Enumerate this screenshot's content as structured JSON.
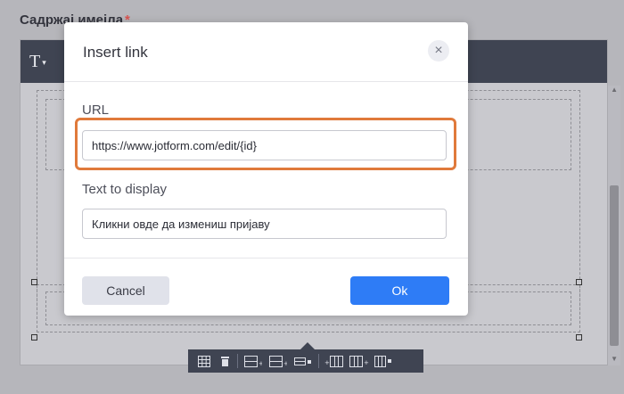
{
  "background": {
    "field_label": "Садржај имејла",
    "required_mark": "*",
    "font_button": "T",
    "font_caret": "▾"
  },
  "dialog": {
    "title": "Insert link",
    "close_icon": "×",
    "url_label": "URL",
    "url_value": "https://www.jotform.com/edit/{id}",
    "display_label": "Text to display",
    "display_value": "Кликни овде да измениш пријаву",
    "cancel_label": "Cancel",
    "ok_label": "Ok"
  },
  "colors": {
    "highlight": "#e07a3b",
    "primary": "#2e7cf6",
    "toolbar": "#3f4452"
  },
  "table_toolbar": {
    "icons": [
      "table-properties-icon",
      "delete-table-icon",
      "insert-row-before-icon",
      "insert-row-after-icon",
      "delete-row-icon",
      "insert-column-before-icon",
      "insert-column-after-icon",
      "delete-column-icon"
    ]
  }
}
